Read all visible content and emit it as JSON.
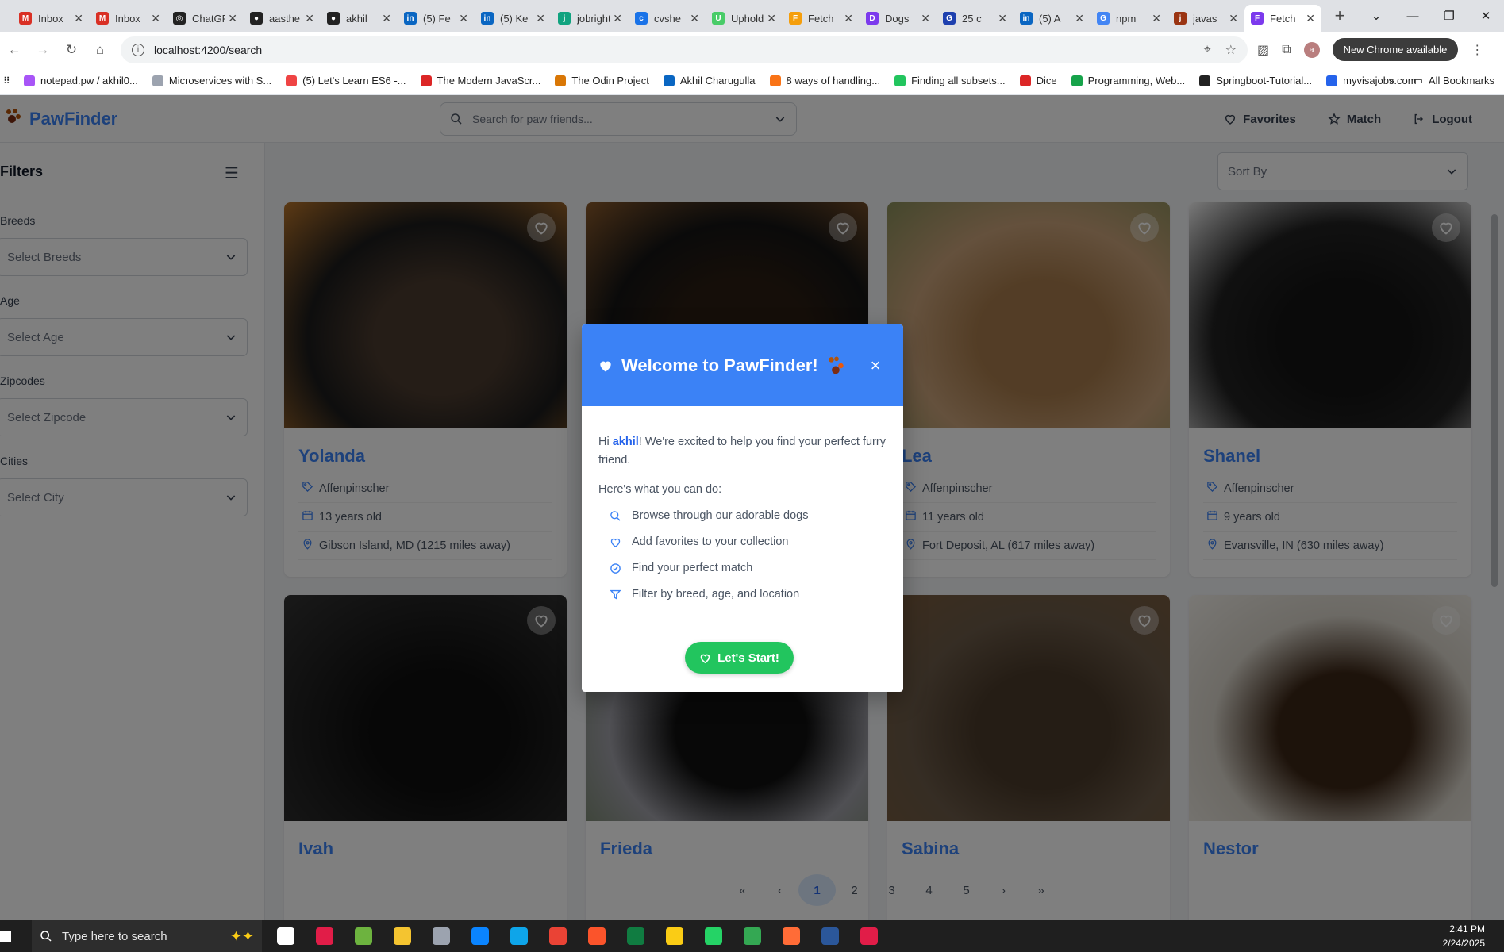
{
  "browser": {
    "tabs": [
      {
        "label": "Inbox",
        "color": "#d93025",
        "glyph": "M"
      },
      {
        "label": "Inbox",
        "color": "#d93025",
        "glyph": "M"
      },
      {
        "label": "ChatGPT",
        "color": "#222222",
        "glyph": "◎"
      },
      {
        "label": "aasthe",
        "color": "#222222",
        "glyph": "●"
      },
      {
        "label": "akhil",
        "color": "#222222",
        "glyph": "●"
      },
      {
        "label": "(5) Fe",
        "color": "#0a66c2",
        "glyph": "in"
      },
      {
        "label": "(5) Ke",
        "color": "#0a66c2",
        "glyph": "in"
      },
      {
        "label": "jobright",
        "color": "#10a37f",
        "glyph": "j"
      },
      {
        "label": "cvshe",
        "color": "#1a73e8",
        "glyph": "c"
      },
      {
        "label": "Uphold",
        "color": "#49cc68",
        "glyph": "U"
      },
      {
        "label": "Fetch",
        "color": "#f59e0b",
        "glyph": "F"
      },
      {
        "label": "Dogs",
        "color": "#7c3aed",
        "glyph": "D"
      },
      {
        "label": "25 c",
        "color": "#1e40af",
        "glyph": "G"
      },
      {
        "label": "(5) A",
        "color": "#0a66c2",
        "glyph": "in"
      },
      {
        "label": "npm",
        "color": "#4285f4",
        "glyph": "G"
      },
      {
        "label": "javas",
        "color": "#9a3412",
        "glyph": "j"
      },
      {
        "label": "Fetch",
        "color": "#7c3aed",
        "glyph": "F",
        "active": true
      }
    ],
    "new_tab": "+",
    "url": "localhost:4200/search",
    "update_label": "New Chrome available",
    "profile_initial": "a",
    "bookmarks": [
      {
        "label": "notepad.pw / akhil0...",
        "color": "#a855f7"
      },
      {
        "label": "Microservices with S...",
        "color": "#9ca3af"
      },
      {
        "label": "(5) Let's Learn ES6 -...",
        "color": "#ef4444"
      },
      {
        "label": "The Modern JavaScr...",
        "color": "#dc2626"
      },
      {
        "label": "The Odin Project",
        "color": "#d97706"
      },
      {
        "label": "Akhil Charugulla",
        "color": "#0a66c2"
      },
      {
        "label": "8 ways of handling...",
        "color": "#f97316"
      },
      {
        "label": "Finding all subsets...",
        "color": "#22c55e"
      },
      {
        "label": "Dice",
        "color": "#dc2626"
      },
      {
        "label": "Programming, Web...",
        "color": "#16a34a"
      },
      {
        "label": "Springboot-Tutorial...",
        "color": "#222222"
      },
      {
        "label": "myvisajobs.com",
        "color": "#2563eb"
      }
    ],
    "all_bookmarks": "All Bookmarks"
  },
  "app": {
    "brand": "PawFinder",
    "search_placeholder": "Search for paw friends...",
    "nav": {
      "favorites": "Favorites",
      "match": "Match",
      "logout": "Logout"
    },
    "filters": {
      "title": "Filters",
      "groups": [
        {
          "label": "Breeds",
          "placeholder": "Select Breeds"
        },
        {
          "label": "Age",
          "placeholder": "Select Age"
        },
        {
          "label": "Zipcodes",
          "placeholder": "Select Zipcode"
        },
        {
          "label": "Cities",
          "placeholder": "Select City"
        }
      ]
    },
    "sort_label": "Sort By",
    "dogs": [
      {
        "name": "Yolanda",
        "breed": "Affenpinscher",
        "age": "13 years old",
        "location": "Gibson Island, MD (1215 miles away)",
        "photo_colors": [
          "#b8742a",
          "#4a3a2e",
          "#1c1c1c"
        ]
      },
      {
        "name": "",
        "breed": "",
        "age": "",
        "location": "",
        "photo_colors": [
          "#8b5a2b",
          "#2b1d12",
          "#151515"
        ]
      },
      {
        "name": "Lea",
        "breed": "Affenpinscher",
        "age": "11 years old",
        "location": "Fort Deposit, AL (617 miles away)",
        "photo_colors": [
          "#8a8f5a",
          "#a77b4c",
          "#c9a27a"
        ]
      },
      {
        "name": "Shanel",
        "breed": "Affenpinscher",
        "age": "9 years old",
        "location": "Evansville, IN (630 miles away)",
        "photo_colors": [
          "#f3f3f3",
          "#151515",
          "#222222"
        ]
      },
      {
        "name": "Ivah",
        "photo_colors": [
          "#333333",
          "#0e0e0e",
          "#1e1e1e"
        ]
      },
      {
        "name": "Frieda",
        "photo_colors": [
          "#6b7f5a",
          "#111111",
          "#a0a0a8"
        ]
      },
      {
        "name": "Sabina",
        "photo_colors": [
          "#7a5a3c",
          "#4a3a2a",
          "#6b5a48"
        ]
      },
      {
        "name": "Nestor",
        "photo_colors": [
          "#f3f0ea",
          "#3b2616",
          "#d9d4ca"
        ]
      }
    ],
    "pagination": {
      "pages": [
        "1",
        "2",
        "3",
        "4",
        "5"
      ],
      "current": "1",
      "first": "«",
      "prev": "‹",
      "next": "›",
      "last": "»"
    }
  },
  "modal": {
    "title": "Welcome to PawFinder!",
    "close": "×",
    "greeting_prefix": "Hi ",
    "user": "akhil",
    "greeting_suffix": "! We're excited to help you find your perfect furry friend.",
    "subheading": "Here's what you can do:",
    "features": [
      {
        "icon": "search-icon",
        "text": "Browse through our adorable dogs"
      },
      {
        "icon": "heart-icon",
        "text": "Add favorites to your collection"
      },
      {
        "icon": "check-circle-icon",
        "text": "Find your perfect match"
      },
      {
        "icon": "filter-icon",
        "text": "Filter by breed, age, and location"
      }
    ],
    "cta": "Let's Start!"
  },
  "taskbar": {
    "search_placeholder": "Type here to search",
    "time": "2:41 PM",
    "date": "2/24/2025",
    "apps": [
      {
        "name": "task-view",
        "color": "#ffffff"
      },
      {
        "name": "intellij",
        "color": "#e11d48"
      },
      {
        "name": "spring",
        "color": "#6db33f"
      },
      {
        "name": "file-explorer",
        "color": "#f4c430"
      },
      {
        "name": "calculator",
        "color": "#9ca3af"
      },
      {
        "name": "vscode",
        "color": "#0a84ff"
      },
      {
        "name": "edge",
        "color": "#0ea5e9"
      },
      {
        "name": "chrome",
        "color": "#ea4335"
      },
      {
        "name": "brave",
        "color": "#fb542b"
      },
      {
        "name": "excel",
        "color": "#107c41"
      },
      {
        "name": "sticky-notes",
        "color": "#facc15"
      },
      {
        "name": "whatsapp",
        "color": "#25d366"
      },
      {
        "name": "chrome-2",
        "color": "#34a853"
      },
      {
        "name": "postman",
        "color": "#ff6c37"
      },
      {
        "name": "word",
        "color": "#2b579a"
      },
      {
        "name": "sourcetree",
        "color": "#e11d48"
      }
    ]
  }
}
